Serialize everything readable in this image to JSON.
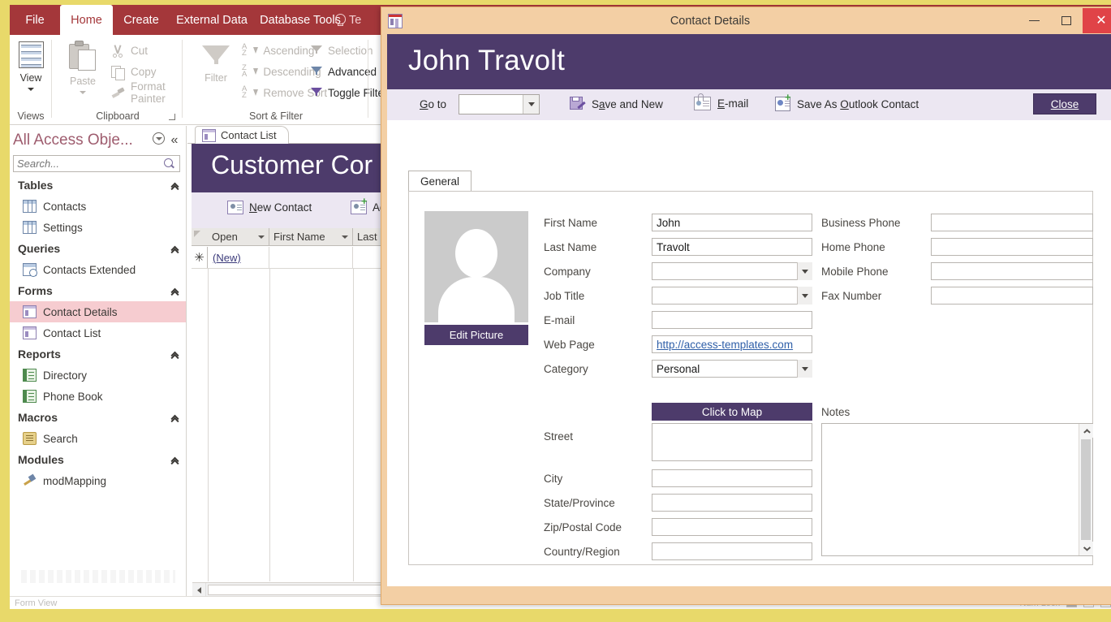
{
  "app": {
    "ribbon_tabs": [
      {
        "label": "File",
        "active": false
      },
      {
        "label": "Home",
        "active": true
      },
      {
        "label": "Create",
        "active": false
      },
      {
        "label": "External Data",
        "active": false
      },
      {
        "label": "Database Tools",
        "active": false
      }
    ],
    "tell_me": "Te",
    "groups": {
      "views": {
        "label": "Views",
        "view_button": "View"
      },
      "clipboard": {
        "label": "Clipboard",
        "paste": "Paste",
        "items": [
          "Cut",
          "Copy",
          "Format Painter"
        ]
      },
      "sort_filter": {
        "label": "Sort & Filter",
        "filter": "Filter",
        "col1": [
          "Ascending",
          "Descending",
          "Remove Sort"
        ],
        "col2": [
          "Selection",
          "Advanced",
          "Toggle Filter"
        ]
      }
    }
  },
  "navpane": {
    "title": "All Access Obje...",
    "search_placeholder": "Search...",
    "groups": [
      {
        "label": "Tables",
        "items": [
          {
            "label": "Contacts",
            "icon": "table-icon",
            "selected": false
          },
          {
            "label": "Settings",
            "icon": "table-icon",
            "selected": false
          }
        ]
      },
      {
        "label": "Queries",
        "items": [
          {
            "label": "Contacts Extended",
            "icon": "query-icon",
            "selected": false
          }
        ]
      },
      {
        "label": "Forms",
        "items": [
          {
            "label": "Contact Details",
            "icon": "form-icon",
            "selected": true
          },
          {
            "label": "Contact List",
            "icon": "form-icon",
            "selected": false
          }
        ]
      },
      {
        "label": "Reports",
        "items": [
          {
            "label": "Directory",
            "icon": "report-icon",
            "selected": false
          },
          {
            "label": "Phone Book",
            "icon": "report-icon",
            "selected": false
          }
        ]
      },
      {
        "label": "Macros",
        "items": [
          {
            "label": "Search",
            "icon": "macro-icon",
            "selected": false
          }
        ]
      },
      {
        "label": "Modules",
        "items": [
          {
            "label": "modMapping",
            "icon": "module-icon",
            "selected": false
          }
        ]
      }
    ]
  },
  "document": {
    "tab_label": "Contact List",
    "banner_title": "Customer Cor",
    "actions": [
      {
        "label": "New Contact",
        "icon": "new-contact-icon"
      },
      {
        "label": "Ad",
        "icon": "add-from-outlook-icon"
      }
    ],
    "grid": {
      "columns": [
        "Open",
        "First Name",
        "Last"
      ],
      "rows": [
        {
          "marker": "✳",
          "open": "(New)",
          "first_name": "",
          "last_name": ""
        }
      ]
    }
  },
  "statusbar": {
    "left": "Form View",
    "right": "Num Lock"
  },
  "dialog": {
    "title": "Contact Details",
    "window_buttons": {
      "minimize": "–",
      "maximize": "❐",
      "close": "✕"
    },
    "banner_title": "John Travolt",
    "actionbar": {
      "goto_label": "Go to",
      "goto_value": "",
      "actions": [
        {
          "label": "Save and New",
          "icon": "save-icon"
        },
        {
          "label": "E-mail",
          "icon": "email-icon"
        },
        {
          "label": "Save As Outlook Contact",
          "icon": "outlook-contact-icon"
        }
      ],
      "close_label": "Close"
    },
    "tabs": [
      {
        "label": "General",
        "active": true
      }
    ],
    "photo": {
      "edit_button": "Edit Picture"
    },
    "fields_left": [
      {
        "label": "First Name",
        "value": "John",
        "type": "text"
      },
      {
        "label": "Last Name",
        "value": "Travolt",
        "type": "text"
      },
      {
        "label": "Company",
        "value": "",
        "type": "combo"
      },
      {
        "label": "Job Title",
        "value": "",
        "type": "combo"
      },
      {
        "label": "E-mail",
        "value": "",
        "type": "text"
      },
      {
        "label": "Web Page",
        "value": "http://access-templates.com",
        "type": "link"
      },
      {
        "label": "Category",
        "value": "Personal",
        "type": "combo"
      }
    ],
    "fields_right": [
      {
        "label": "Business Phone",
        "value": "",
        "type": "text"
      },
      {
        "label": "Home Phone",
        "value": "",
        "type": "text"
      },
      {
        "label": "Mobile Phone",
        "value": "",
        "type": "text"
      },
      {
        "label": "Fax Number",
        "value": "",
        "type": "text"
      }
    ],
    "map_button": "Click to Map",
    "address_fields": [
      {
        "label": "Street",
        "value": "",
        "type": "textarea"
      },
      {
        "label": "City",
        "value": "",
        "type": "text"
      },
      {
        "label": "State/Province",
        "value": "",
        "type": "text"
      },
      {
        "label": "Zip/Postal Code",
        "value": "",
        "type": "text"
      },
      {
        "label": "Country/Region",
        "value": "",
        "type": "text"
      }
    ],
    "notes_label": "Notes",
    "notes_value": ""
  },
  "colors": {
    "ribbon_red": "#a4373a",
    "accent_purple": "#4d3b6b",
    "light_purple": "#ece7f2",
    "dialog_frame": "#f3cfa4",
    "window_border": "#e8d96a",
    "selection_pink": "#f6ccd0",
    "close_red": "#e04347",
    "link_blue": "#2f5fa8"
  }
}
